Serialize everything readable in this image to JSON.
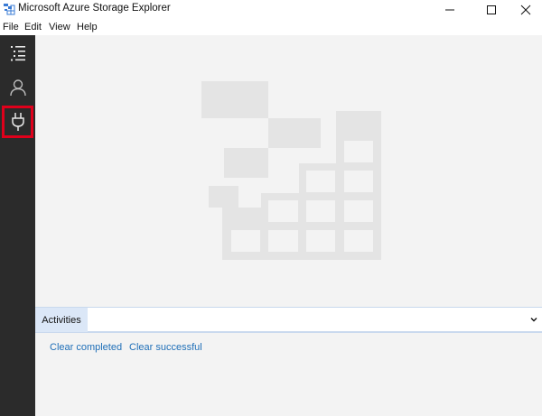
{
  "window": {
    "title": "Microsoft Azure Storage Explorer",
    "icon": "storage-explorer-app-icon",
    "controls": [
      "minimize-icon",
      "maximize-icon",
      "close-icon"
    ]
  },
  "menu": {
    "items": [
      {
        "label": "File"
      },
      {
        "label": "Edit"
      },
      {
        "label": "View"
      },
      {
        "label": "Help"
      }
    ]
  },
  "activity_bar": {
    "items": [
      {
        "icon": "explorer-list-icon",
        "selected": false
      },
      {
        "icon": "account-person-icon",
        "selected": false
      },
      {
        "icon": "connect-plug-icon",
        "selected": true
      }
    ],
    "highlight_color": "#e0001b"
  },
  "activities": {
    "tab_label": "Activities",
    "clear_completed": "Clear completed",
    "clear_successful": "Clear successful",
    "link_color": "#1f6fb8"
  }
}
